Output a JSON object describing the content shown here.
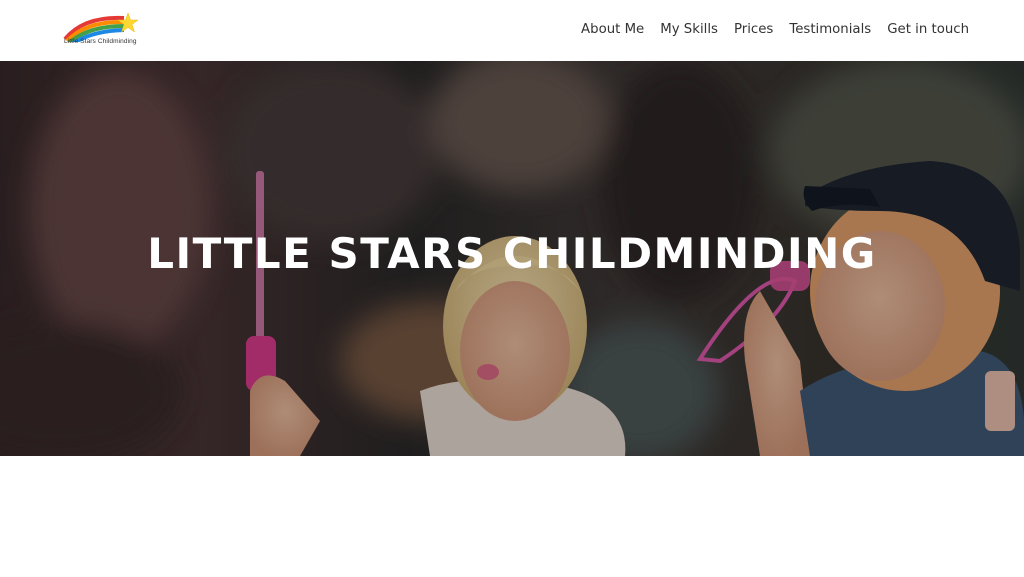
{
  "header": {
    "logo_text": "Little Stars Childminding",
    "nav": [
      {
        "label": "About Me"
      },
      {
        "label": "My Skills"
      },
      {
        "label": "Prices"
      },
      {
        "label": "Testimonials"
      },
      {
        "label": "Get in touch"
      }
    ]
  },
  "hero": {
    "title": "LITTLE STARS CHILDMINDING",
    "image": "children-blowing-bubbles-photo"
  },
  "colors": {
    "nav_text": "#333333",
    "hero_title": "#ffffff",
    "rainbow": [
      "#e53935",
      "#fb8c00",
      "#43a047",
      "#1e88e5"
    ],
    "star": "#fdd835"
  }
}
